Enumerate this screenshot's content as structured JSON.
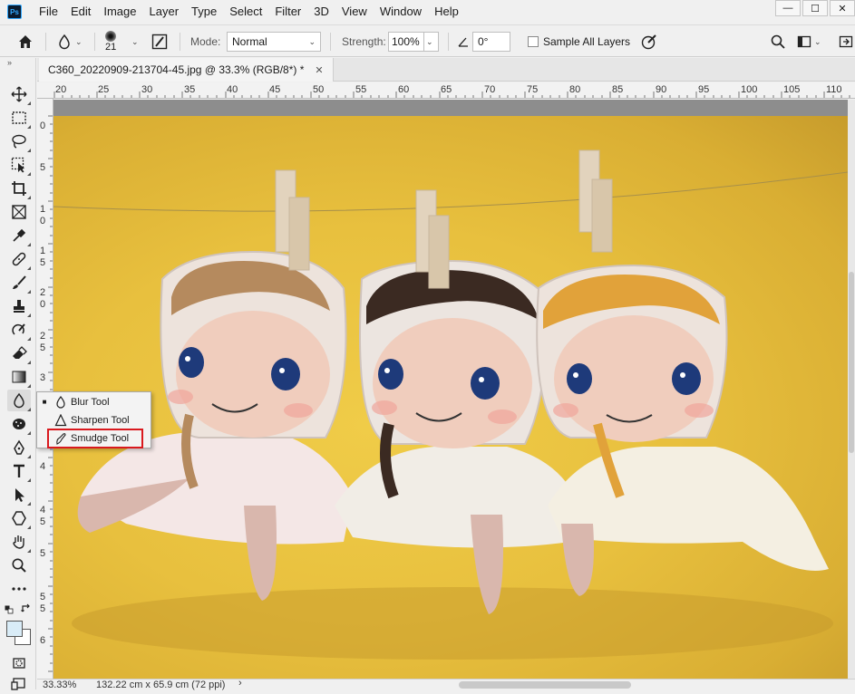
{
  "menubar": {
    "logo": "Ps",
    "items": [
      "File",
      "Edit",
      "Image",
      "Layer",
      "Type",
      "Select",
      "Filter",
      "3D",
      "View",
      "Window",
      "Help"
    ],
    "window_controls": {
      "minimize": "—",
      "maximize": "☐",
      "close": "✕"
    }
  },
  "options": {
    "brush_size": "21",
    "mode_label": "Mode:",
    "mode_value": "Normal",
    "strength_label": "Strength:",
    "strength_value": "100%",
    "angle_value": "0°",
    "sample_all_layers": "Sample All Layers"
  },
  "document": {
    "tab_title": "C360_20220909-213704-45.jpg @ 33.3% (RGB/8*) *",
    "tab_close": "✕"
  },
  "rulers": {
    "horizontal": [
      "20",
      "25",
      "30",
      "35",
      "40",
      "45",
      "50",
      "55",
      "60",
      "65",
      "70",
      "75",
      "80",
      "85",
      "90",
      "95",
      "100",
      "105",
      "110"
    ],
    "vertical": [
      "0",
      "5",
      "1 0",
      "1 5",
      "2 0",
      "2 5",
      "3",
      "3 5",
      "4",
      "4 5",
      "5",
      "5 5",
      "6"
    ]
  },
  "flyout": {
    "items": [
      {
        "label": "Blur Tool",
        "selected": true
      },
      {
        "label": "Sharpen Tool",
        "selected": false
      },
      {
        "label": "Smudge Tool",
        "selected": false
      }
    ],
    "highlight_color": "#d9191e"
  },
  "toolbar": {
    "tools": [
      "move-tool",
      "marquee-tool",
      "lasso-tool",
      "object-select-tool",
      "crop-tool",
      "frame-tool",
      "eyedropper-tool",
      "healing-tool",
      "brush-tool",
      "stamp-tool",
      "history-brush-tool",
      "eraser-tool",
      "gradient-tool",
      "blur-tool",
      "dodge-tool",
      "pen-tool",
      "type-tool",
      "path-select-tool",
      "shape-tool",
      "hand-tool",
      "zoom-tool",
      "more-tools"
    ],
    "foreground_color": "#d9ecf7",
    "background_color": "#ffffff"
  },
  "status": {
    "zoom": "33.33%",
    "doc_size": "132.22 cm x 65.9 cm (72 ppi)",
    "arrow": "›"
  }
}
